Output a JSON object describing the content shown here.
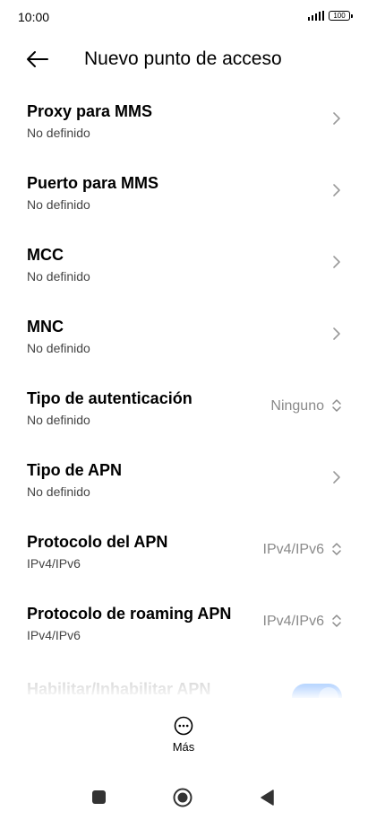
{
  "status_bar": {
    "time": "10:00",
    "battery": "100"
  },
  "header": {
    "title": "Nuevo punto de acceso",
    "back_icon": "arrow-left-icon"
  },
  "rows": [
    {
      "title": "Proxy para MMS",
      "subtitle": "No definido",
      "control": "chevron"
    },
    {
      "title": "Puerto para MMS",
      "subtitle": "No definido",
      "control": "chevron"
    },
    {
      "title": "MCC",
      "subtitle": "No definido",
      "control": "chevron"
    },
    {
      "title": "MNC",
      "subtitle": "No definido",
      "control": "chevron"
    },
    {
      "title": "Tipo de autenticación",
      "subtitle": "No definido",
      "control": "dropdown",
      "value": "Ninguno"
    },
    {
      "title": "Tipo de APN",
      "subtitle": "No definido",
      "control": "chevron"
    },
    {
      "title": "Protocolo del APN",
      "subtitle": "IPv4/IPv6",
      "control": "dropdown",
      "value": "IPv4/IPv6"
    },
    {
      "title": "Protocolo de roaming APN",
      "subtitle": "IPv4/IPv6",
      "control": "dropdown",
      "value": "IPv4/IPv6"
    }
  ],
  "faded_row": {
    "title": "Habilitar/Inhabilitar APN",
    "toggle_on": true
  },
  "more": {
    "label": "Más",
    "icon": "more-horizontal-icon"
  },
  "nav": {
    "recents_icon": "square-icon",
    "home_icon": "circle-icon",
    "back_icon": "triangle-back-icon"
  },
  "colors": {
    "accent": "#7fb4ff",
    "secondary_text": "#8a8a8a"
  }
}
